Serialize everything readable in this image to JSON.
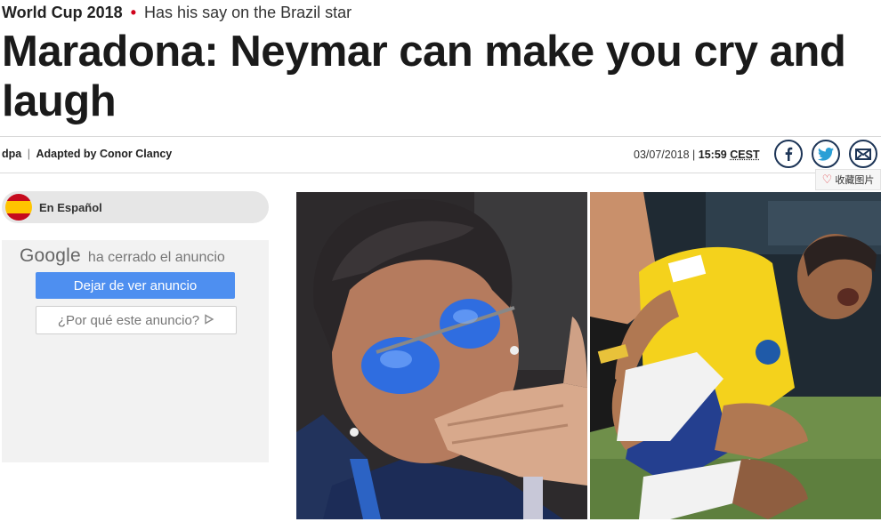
{
  "kicker": {
    "section": "World Cup 2018",
    "separator": "•",
    "subtitle": "Has his say on the Brazil star"
  },
  "headline": "Maradona: Neymar can make you cry and laugh",
  "byline": {
    "agency": "dpa",
    "separator": "|",
    "prefix": "Adapted by",
    "author": "Conor Clancy"
  },
  "dateline": {
    "date": "03/07/2018",
    "separator": "|",
    "time": "15:59",
    "timezone": "CEST"
  },
  "share": {
    "icons": [
      "facebook-icon",
      "twitter-icon",
      "email-icon"
    ]
  },
  "save_image": {
    "label": "收藏图片",
    "icon": "heart-outline-icon"
  },
  "language": {
    "label": "En Español",
    "icon": "spain-flag-icon"
  },
  "ad_closed": {
    "google": "Google",
    "message": "ha cerrado el anuncio",
    "stop_button": "Dejar de ver anuncio",
    "why_button": "¿Por qué este anuncio?",
    "why_icon": "adchoices-icon"
  },
  "photos": [
    {
      "subject": "maradona-blowing-kiss"
    },
    {
      "subject": "neymar-on-ground"
    }
  ],
  "colors": {
    "accent_dot": "#d0021b",
    "share_border": "#1d3557",
    "ad_primary": "#4e8ff0",
    "pill_bg": "#e6e6e6"
  }
}
